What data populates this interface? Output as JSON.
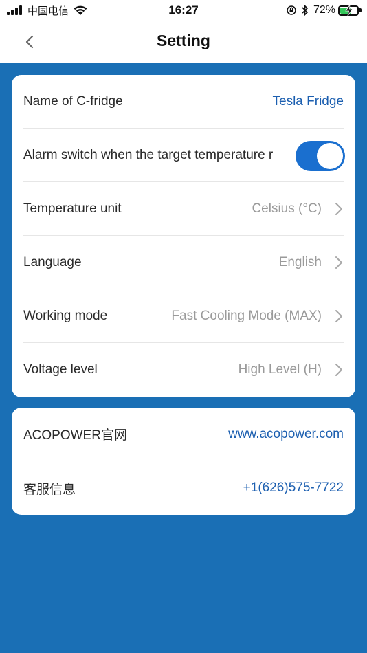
{
  "status_bar": {
    "carrier": "中国电信",
    "time": "16:27",
    "battery_text": "72%",
    "battery_level": 0.72
  },
  "nav": {
    "title": "Setting",
    "back_icon": "chevron-left-icon"
  },
  "settings": {
    "name_label": "Name of C-fridge",
    "name_value": "Tesla Fridge",
    "alarm_label": "Alarm switch when the target temperature r",
    "alarm_on": true,
    "temp_unit_label": "Temperature unit",
    "temp_unit_value": "Celsius (°C)",
    "language_label": "Language",
    "language_value": "English",
    "working_mode_label": "Working mode",
    "working_mode_value": "Fast Cooling Mode (MAX)",
    "voltage_label": "Voltage level",
    "voltage_value": "High Level (H)"
  },
  "contact": {
    "website_label": "ACOPOWER官网",
    "website_value": "www.acopower.com",
    "service_label": "客服信息",
    "service_value": "+1(626)575-7722"
  },
  "colors": {
    "background": "#1a6fb5",
    "link": "#1c5fb0",
    "toggle_on": "#1a6fcf",
    "value_gray": "#9a9a9a"
  }
}
